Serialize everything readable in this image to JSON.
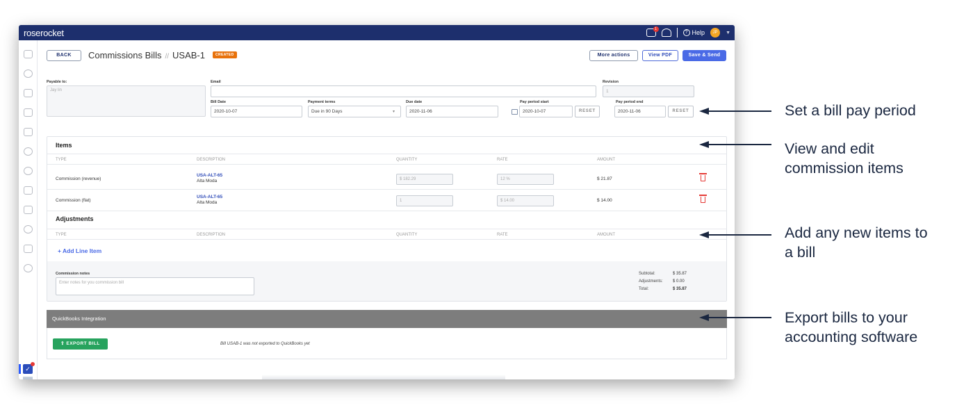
{
  "app": {
    "name": "roserocket"
  },
  "topbar": {
    "notif_badge": "1",
    "help_label": "Help",
    "avatar_initials": "JP"
  },
  "page": {
    "back_label": "BACK",
    "title": "Commissions Bills",
    "separator": "//",
    "bill_id": "USAB-1",
    "status_badge": "CREATED",
    "more_actions_label": "More actions",
    "view_pdf_label": "View PDF",
    "save_send_label": "Save & Send"
  },
  "form": {
    "payable_to_label": "Payable to:",
    "payable_to_value": "Jay lin",
    "email_label": "Email",
    "email_value": "",
    "revision_label": "Revision",
    "revision_value": "1",
    "bill_date_label": "Bill Date",
    "bill_date_value": "2020-10-07",
    "payment_terms_label": "Payment terms",
    "payment_terms_value": "Due in 90 Days",
    "due_date_label": "Due date",
    "due_date_value": "2020-11-06",
    "pay_start_label": "Pay period start",
    "pay_start_value": "2020-10-07",
    "pay_end_label": "Pay period end",
    "pay_end_value": "2020-11-06",
    "reset_label": "RESET"
  },
  "items": {
    "heading": "Items",
    "columns": {
      "type": "TYPE",
      "description": "DESCRIPTION",
      "quantity": "QUANTITY",
      "rate": "RATE",
      "amount": "AMOUNT"
    },
    "rows": [
      {
        "type": "Commission (revenue)",
        "desc_link": "USA-ALT-65",
        "desc_sub": "Alta Moda",
        "quantity": "$ 182.29",
        "rate": "12 %",
        "amount": "$ 21.87"
      },
      {
        "type": "Commission (flat)",
        "desc_link": "USA-ALT-65",
        "desc_sub": "Alta Moda",
        "quantity": "1",
        "rate": "$ 14.00",
        "amount": "$ 14.00"
      }
    ]
  },
  "adjustments": {
    "heading": "Adjustments",
    "add_line_label": "+ Add Line Item"
  },
  "notes": {
    "label": "Commission notes",
    "placeholder": "Enter notes for you commission bill"
  },
  "totals": {
    "subtotal_label": "Subtotal:",
    "subtotal_value": "$ 35.87",
    "adjustments_label": "Adjustments:",
    "adjustments_value": "$ 0.00",
    "total_label": "Total:",
    "total_value": "$ 35.87"
  },
  "quickbooks": {
    "heading": "QuickBooks Integration",
    "export_label": "EXPORT BILL",
    "message": "Bill USAB-1 was not exported to QuickBooks yet"
  },
  "annotations": {
    "a1": "Set a bill pay period",
    "a2_line1": "View and edit",
    "a2_line2": "commission items",
    "a3_line1": "Add any new items to",
    "a3_line2": "a bill",
    "a4_line1": "Export bills to your",
    "a4_line2": "accounting software"
  },
  "colors": {
    "topbar": "#1d2f6d",
    "accent": "#4a6ae6",
    "badge": "#e8720c",
    "export": "#27a35e",
    "delete": "#e53935"
  }
}
